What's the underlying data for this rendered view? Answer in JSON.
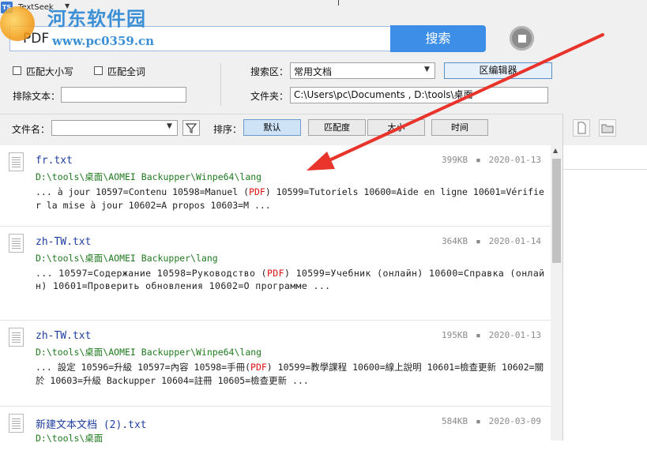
{
  "window": {
    "title": "TextSeek",
    "logo_text": "TS"
  },
  "watermark": {
    "line1": "河东软件园",
    "line2": "www.pc0359.cn"
  },
  "search": {
    "value": "PDF",
    "button_label": "搜索"
  },
  "options": {
    "match_case": "匹配大小写",
    "match_whole": "匹配全词",
    "exclude_label": "排除文本：",
    "exclude_value": ""
  },
  "area": {
    "label": "搜索区：",
    "selected": "常用文档",
    "editor_button": "区编辑器",
    "folder_label": "文件夹：",
    "folder_value": "C:\\Users\\pc\\Documents , D:\\tools\\桌面"
  },
  "filter": {
    "filename_label": "文件名：",
    "filename_value": "",
    "sort_label": "排序：",
    "sort_buttons": [
      "默认",
      "匹配度",
      "大小",
      "时间"
    ]
  },
  "results": [
    {
      "name": "fr.txt",
      "size": "399KB",
      "date": "2020-01-13",
      "path": "D:\\tools\\桌面\\AOMEI Backupper\\Winpe64\\lang",
      "snippet_before": "... à jour 10597=Contenu 10598=Manuel (",
      "snippet_hit": "PDF",
      "snippet_after": ") 10599=Tutoriels 10600=Aide en ligne 10601=Vérifier la mise à jour 10602=A propos 10603=M ..."
    },
    {
      "name": "zh-TW.txt",
      "size": "364KB",
      "date": "2020-01-14",
      "path": "D:\\tools\\桌面\\AOMEI Backupper\\lang",
      "snippet_before": "... 10597=Содержание 10598=Руководство (",
      "snippet_hit": "PDF",
      "snippet_after": ") 10599=Учебник (онлайн) 10600=Справка (онлайн) 10601=Проверить обновления 10602=О программе ..."
    },
    {
      "name": "zh-TW.txt",
      "size": "195KB",
      "date": "2020-01-13",
      "path": "D:\\tools\\桌面\\AOMEI Backupper\\Winpe64\\lang",
      "snippet_before": "... 設定 10596=升級 10597=內容 10598=手冊(",
      "snippet_hit": "PDF",
      "snippet_after": ") 10599=教學課程 10600=線上說明 10601=檢查更新 10602=關於 10603=升級 Backupper 10604=註冊 10605=檢查更新 ..."
    },
    {
      "name": "新建文本文档 (2).txt",
      "size": "584KB",
      "date": "2020-03-09",
      "path": "D:\\tools\\桌面",
      "snippet_before": "",
      "snippet_hit": "",
      "snippet_after": ""
    }
  ],
  "colors": {
    "accent": "#3d8ee6",
    "arrow": "#e8342a",
    "filename": "#1f3fa0",
    "path": "#1f7a1f",
    "highlight": "#dd1111"
  }
}
